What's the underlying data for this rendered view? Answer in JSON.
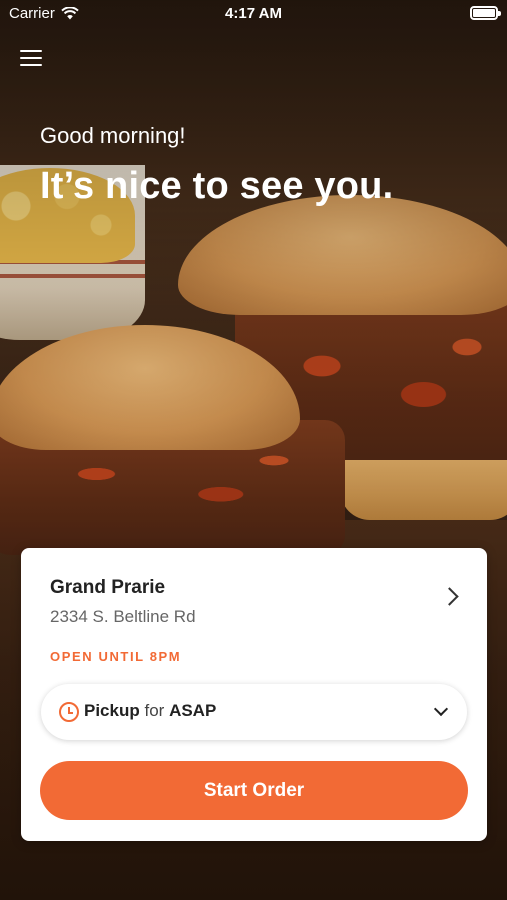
{
  "status_bar": {
    "carrier": "Carrier",
    "time": "4:17 AM"
  },
  "header": {
    "greeting": "Good morning!",
    "headline": "It’s nice to see you."
  },
  "location": {
    "name": "Grand Prarie",
    "address": "2334 S. Beltline Rd",
    "hours": "OPEN UNTIL 8PM"
  },
  "order_mode": {
    "mode": "Pickup",
    "connector": "for",
    "time": "ASAP"
  },
  "actions": {
    "start_order": "Start Order"
  },
  "colors": {
    "accent": "#f26a35",
    "card": "#ffffff"
  },
  "icons": [
    "wifi-icon",
    "battery-icon",
    "menu-icon",
    "chevron-right-icon",
    "clock-icon",
    "chevron-down-icon"
  ]
}
